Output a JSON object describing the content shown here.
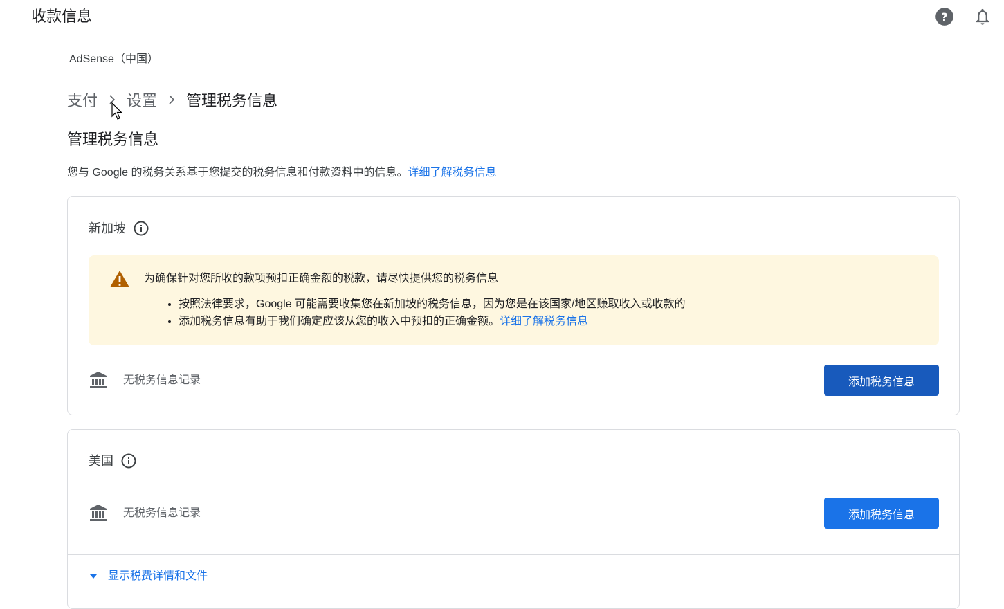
{
  "header": {
    "title": "收款信息",
    "icons": [
      "help-icon",
      "bell-icon"
    ]
  },
  "account": {
    "name": "AdSense（中国）"
  },
  "breadcrumb": {
    "items": [
      "支付",
      "设置",
      "管理税务信息"
    ]
  },
  "page": {
    "heading": "管理税务信息",
    "intro_text": "您与 Google 的税务关系基于您提交的税务信息和付款资料中的信息。",
    "intro_link": "详细了解税务信息"
  },
  "cards": [
    {
      "country": "新加坡",
      "warning": {
        "title": "为确保针对您所收的款项预扣正确金额的税款，请尽快提供您的税务信息",
        "bullets": [
          "按照法律要求，Google 可能需要收集您在新加坡的税务信息，因为您是在该国家/地区赚取收入或收款的",
          "添加税务信息有助于我们确定应该从您的收入中预扣的正确金额。"
        ],
        "link": "详细了解税务信息"
      },
      "no_record": "无税务信息记录",
      "add_button": "添加税务信息"
    },
    {
      "country": "美国",
      "no_record": "无税务信息记录",
      "add_button": "添加税务信息",
      "toggle": "显示税费详情和文件"
    }
  ],
  "colors": {
    "link": "#1a73e8",
    "warning_bg": "#fef7e0",
    "warning_icon": "#b06000",
    "button_dark": "#185abc",
    "button_blue": "#1a73e8"
  }
}
